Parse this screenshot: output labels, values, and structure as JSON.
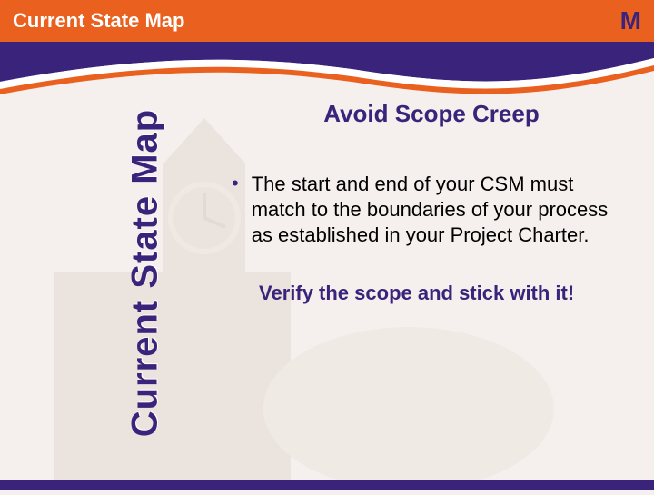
{
  "header": {
    "title": "Current State Map",
    "phase": "M"
  },
  "sidebar": {
    "label": "Current State Map"
  },
  "content": {
    "title": "Avoid Scope Creep",
    "bullets": [
      "The start and end of your CSM must match to the boundaries of your process as established in your Project Charter."
    ],
    "emphasis": "Verify the scope and stick with it!"
  },
  "colors": {
    "orange": "#e9601f",
    "purple": "#3a237a"
  }
}
